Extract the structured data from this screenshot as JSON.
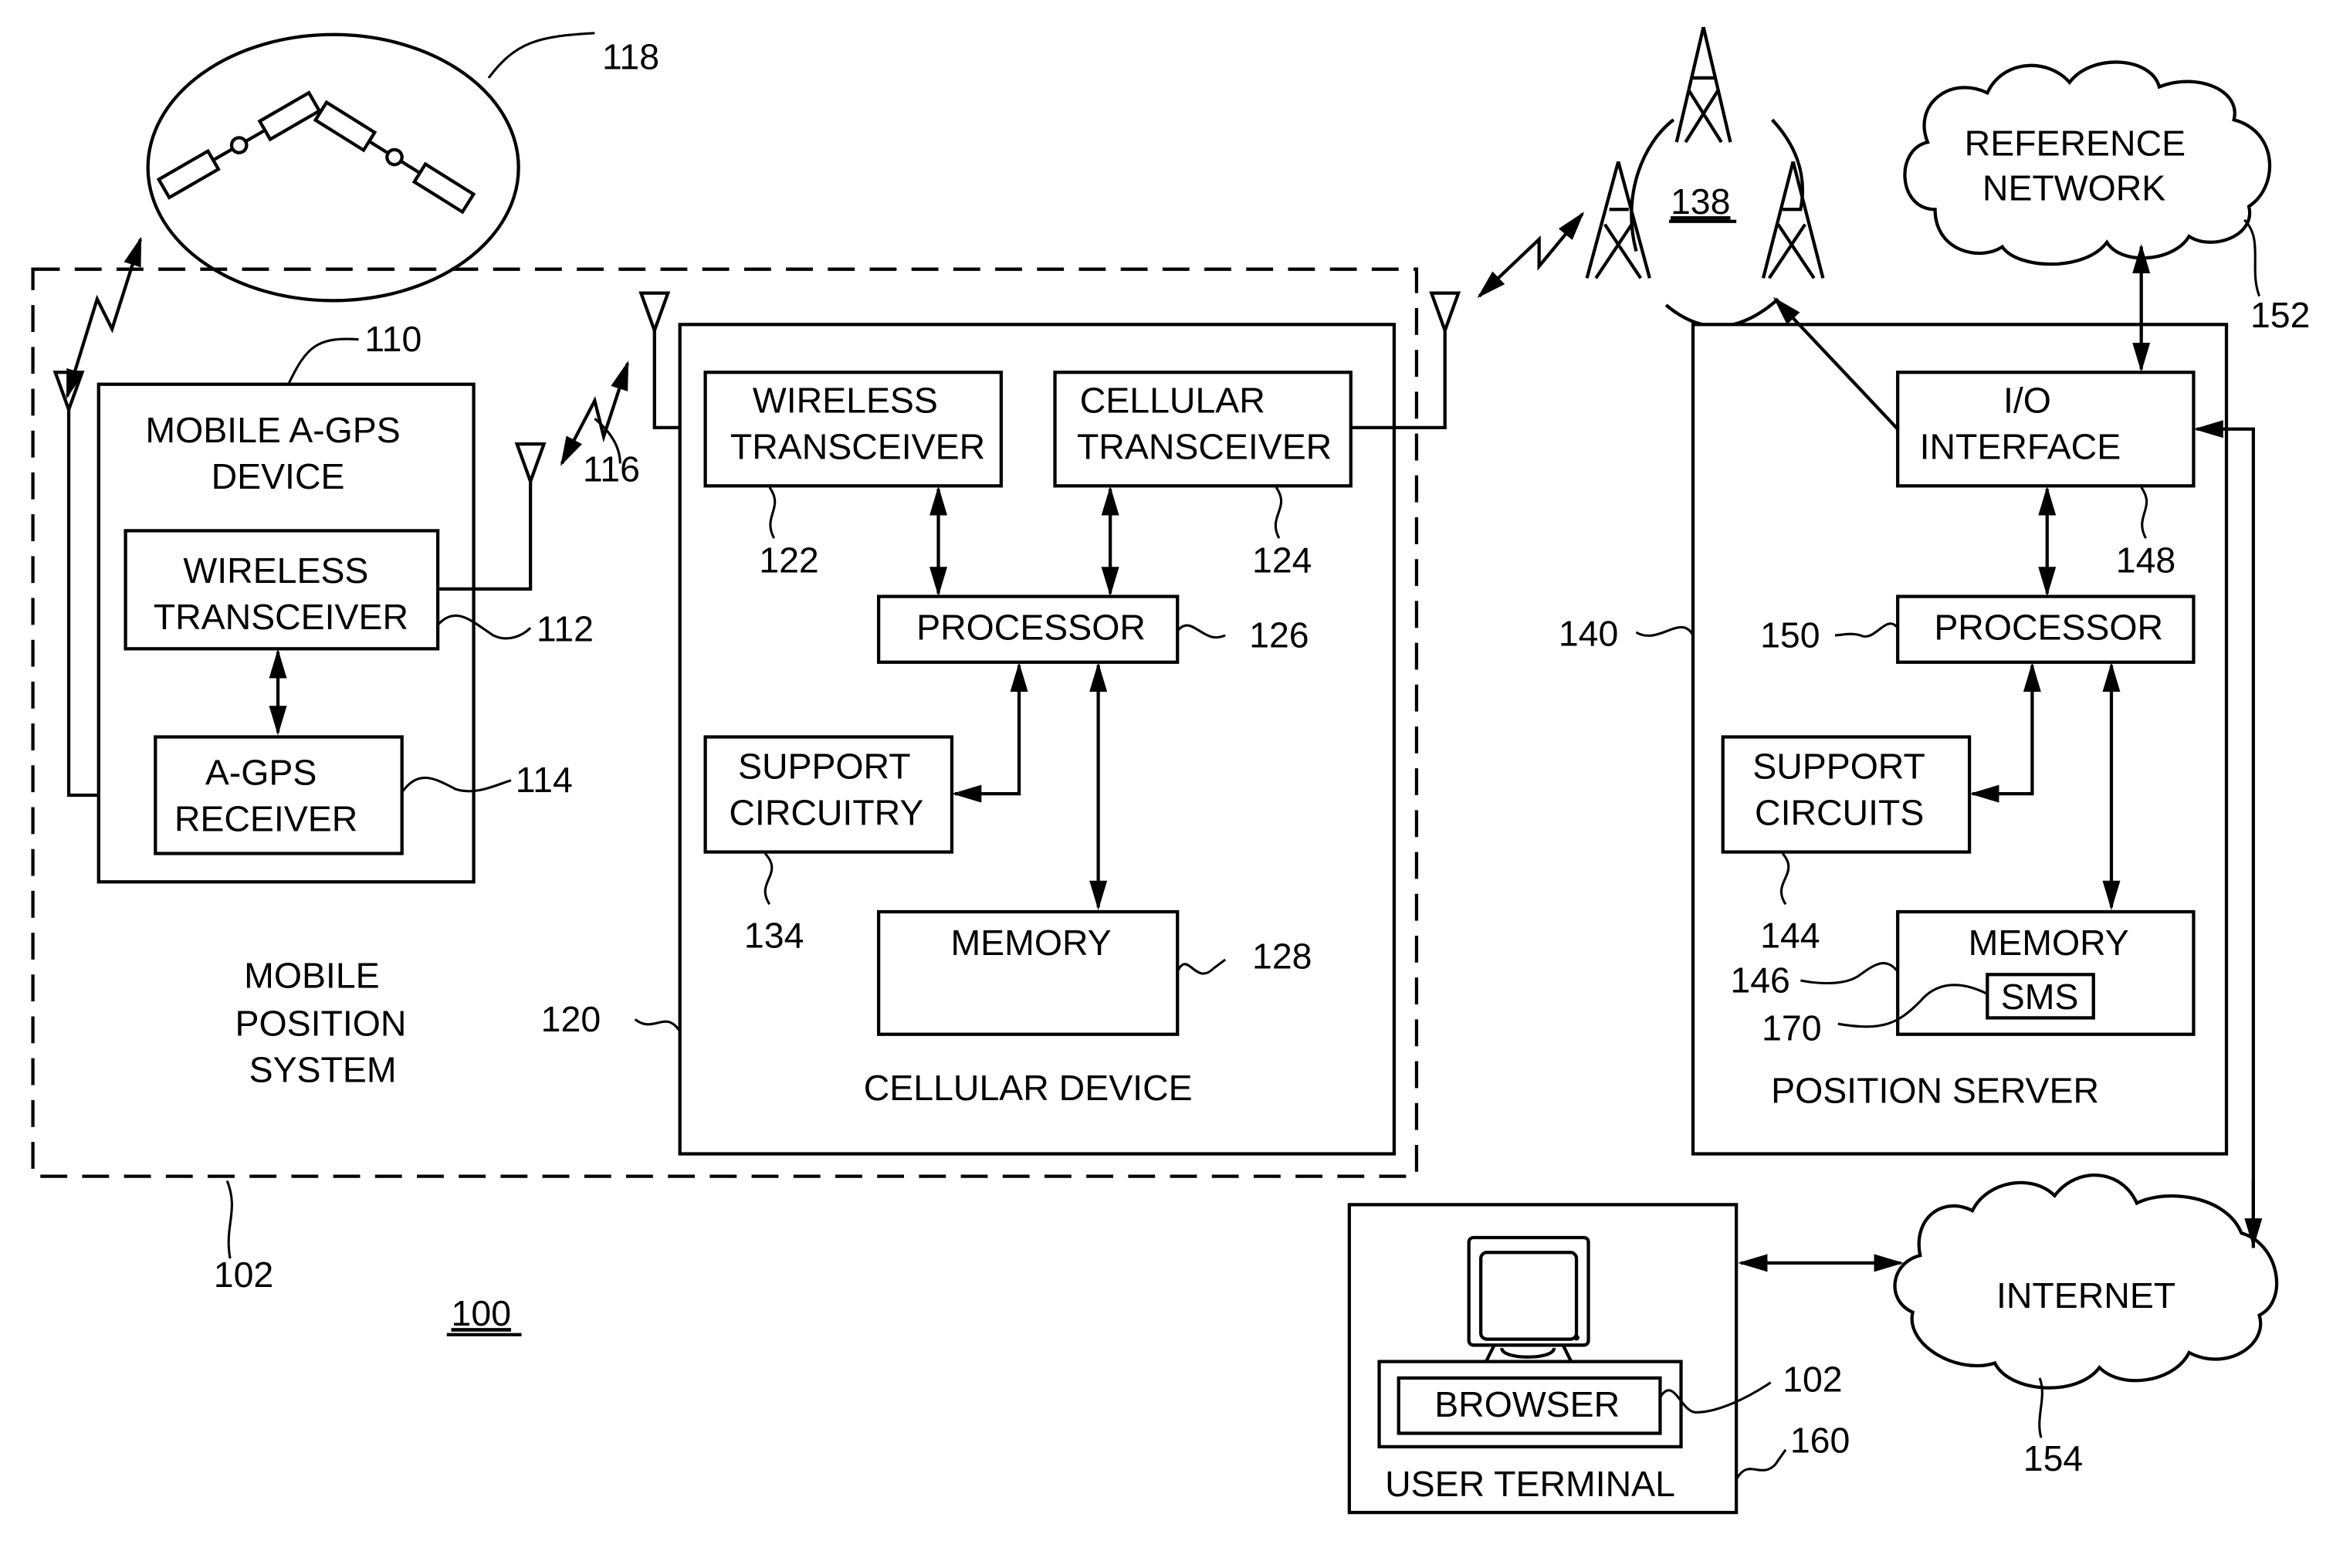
{
  "figure": {
    "figure_ref": "100",
    "satellites_ref": "118",
    "wireless_link_ref": "116",
    "towers_ref": "138",
    "mobile_position_system": {
      "label_lines": [
        "MOBILE",
        "POSITION",
        "SYSTEM"
      ],
      "ref": "102"
    },
    "agps_device": {
      "label_lines": [
        "MOBILE A-GPS",
        "DEVICE"
      ],
      "ref": "110",
      "wireless_transceiver": {
        "label_lines": [
          "WIRELESS",
          "TRANSCEIVER"
        ],
        "ref": "112"
      },
      "agps_receiver": {
        "label_lines": [
          "A-GPS",
          "RECEIVER"
        ],
        "ref": "114"
      }
    },
    "cellular_device": {
      "label": "CELLULAR DEVICE",
      "ref": "120",
      "wireless_transceiver": {
        "label_lines": [
          "WIRELESS",
          "TRANSCEIVER"
        ],
        "ref": "122"
      },
      "cellular_transceiver": {
        "label_lines": [
          "CELLULAR",
          "TRANSCEIVER"
        ],
        "ref": "124"
      },
      "processor": {
        "label": "PROCESSOR",
        "ref": "126"
      },
      "memory": {
        "label": "MEMORY",
        "ref": "128"
      },
      "support_circuitry": {
        "label_lines": [
          "SUPPORT",
          "CIRCUITRY"
        ],
        "ref": "134"
      }
    },
    "position_server": {
      "label": "POSITION SERVER",
      "ref": "140",
      "io_interface": {
        "label_lines": [
          "I/O",
          "INTERFACE"
        ],
        "ref": "148"
      },
      "processor": {
        "label": "PROCESSOR",
        "ref": "150"
      },
      "support_circuits": {
        "label_lines": [
          "SUPPORT",
          "CIRCUITS"
        ],
        "ref": "144"
      },
      "memory": {
        "label": "MEMORY",
        "ref": "146"
      },
      "sms": {
        "label": "SMS",
        "ref": "170"
      }
    },
    "reference_network": {
      "label_lines": [
        "REFERENCE",
        "NETWORK"
      ],
      "ref": "152"
    },
    "internet": {
      "label": "INTERNET",
      "ref": "154"
    },
    "user_terminal": {
      "label": "USER TERMINAL",
      "ref": "160",
      "browser": {
        "label": "BROWSER",
        "ref": "102"
      }
    }
  }
}
